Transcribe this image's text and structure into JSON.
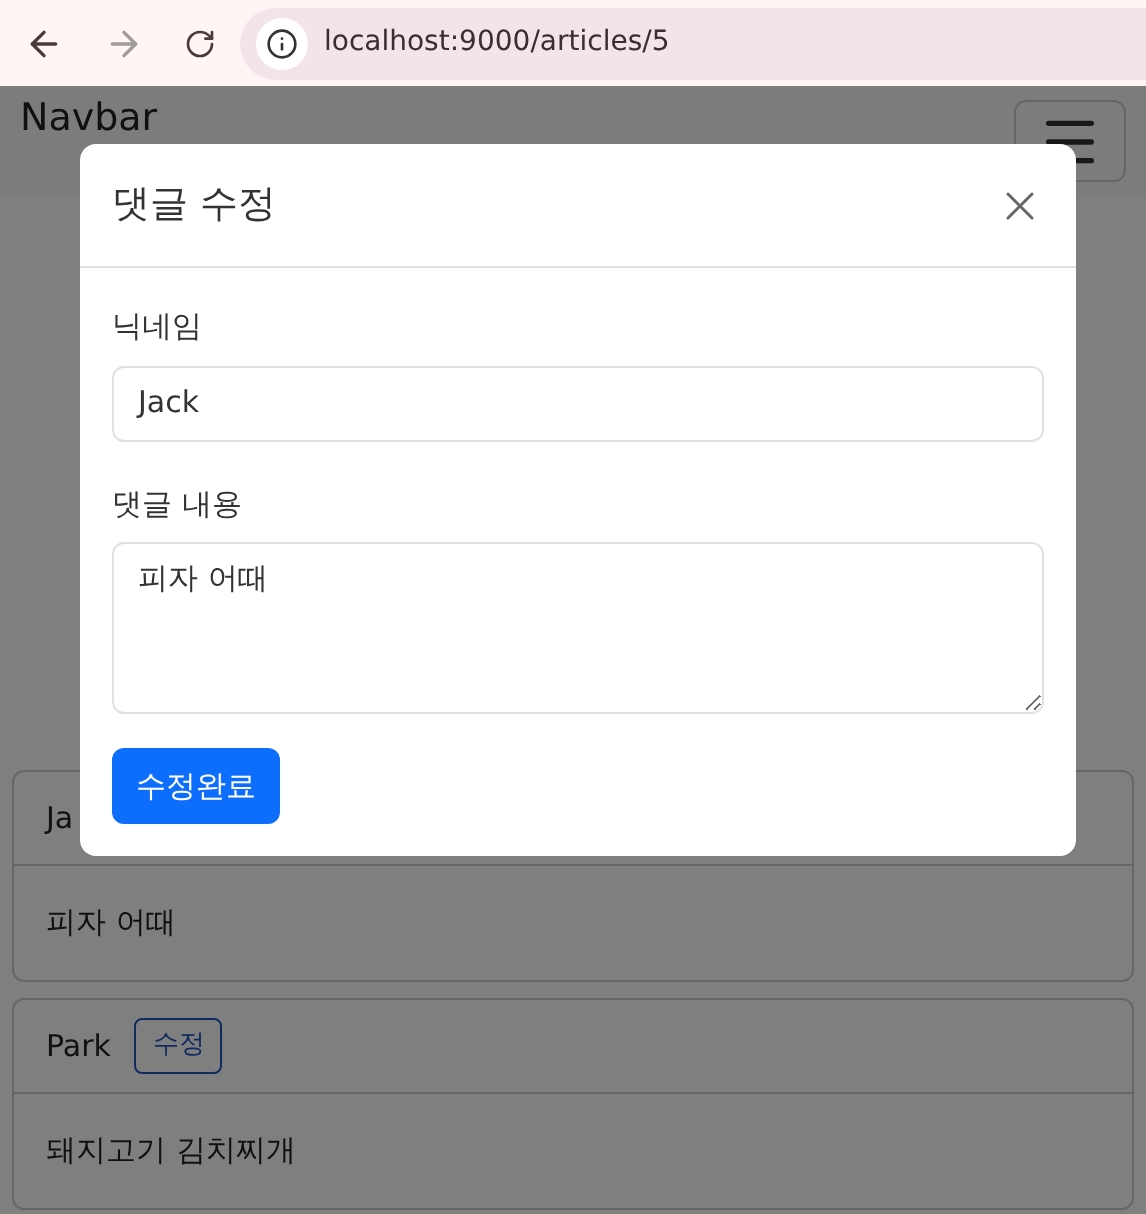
{
  "browser": {
    "url": "localhost:9000/articles/5"
  },
  "navbar": {
    "brand": "Navbar"
  },
  "comments": [
    {
      "author": "Ja",
      "body": "피자 어때"
    },
    {
      "author": "Park",
      "body": "돼지고기 김치찌개",
      "edit_button": "수정"
    }
  ],
  "modal": {
    "title": "댓글 수정",
    "fields": [
      {
        "kind": "input",
        "label": "닉네임",
        "value": "Jack"
      },
      {
        "kind": "textarea",
        "label": "댓글 내용",
        "value": "피자 어때"
      }
    ],
    "submit": "수정완료"
  }
}
